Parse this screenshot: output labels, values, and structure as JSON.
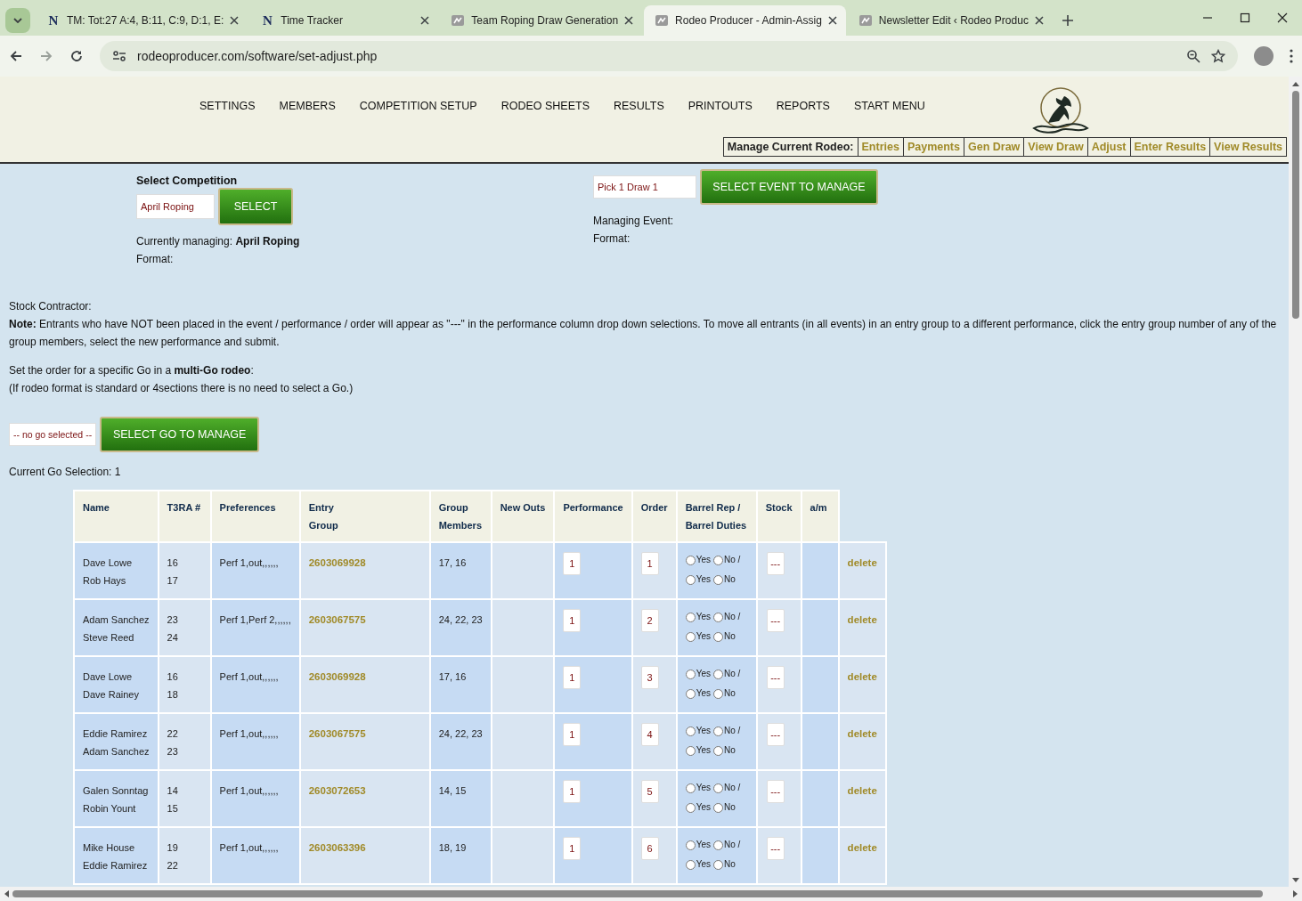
{
  "browser": {
    "tabs": [
      {
        "kind": "letter",
        "icon_text": "N",
        "title": "TM: Tot:27 A:4, B:11, C:9, D:1, E:",
        "selected": false
      },
      {
        "kind": "letter",
        "icon_text": "N",
        "title": "Time Tracker",
        "selected": false
      },
      {
        "kind": "site",
        "title": "Team Roping Draw Generation",
        "selected": false
      },
      {
        "kind": "site",
        "title": "Rodeo Producer - Admin-Assig",
        "selected": true
      },
      {
        "kind": "site",
        "title": "Newsletter Edit ‹ Rodeo Produc",
        "selected": false
      }
    ],
    "address": "rodeoproducer.com/software/set-adjust.php"
  },
  "nav": {
    "items": [
      "SETTINGS",
      "MEMBERS",
      "COMPETITION SETUP",
      "RODEO SHEETS",
      "RESULTS",
      "PRINTOUTS",
      "REPORTS",
      "START MENU"
    ]
  },
  "manage_bar": {
    "label": "Manage Current Rodeo:",
    "links": [
      "Entries",
      "Payments",
      "Gen Draw",
      "View Draw",
      "Adjust",
      "Enter Results",
      "View Results"
    ]
  },
  "competition": {
    "heading": "Select Competition",
    "select_value": "April Roping",
    "button": "SELECT",
    "currently_label": "Currently managing:",
    "currently_value": "April Roping",
    "format_label": "Format:"
  },
  "event": {
    "select_value": "Pick 1 Draw 1",
    "button": "SELECT EVENT TO MANAGE",
    "managing_label": "Managing Event:",
    "format_label": "Format:"
  },
  "stock_contractor": "Stock Contractor:",
  "note": "**Note:** Entrants who have NOT been placed in the event / performance / order will appear as \"---\" in the performance column drop down selections. To move all entrants (in all events) in an entry group to a different performance, click the entry group number of any of the group members, select the new performance and submit.",
  "go_intro": "Set the order for a specific Go in a **multi-Go rodeo**:",
  "go_hint": "(If rodeo format is standard or 4sections there is no need to select a Go.)",
  "go": {
    "select_value": "-- no go selected --",
    "button": "SELECT GO TO MANAGE",
    "current": "Current Go Selection: 1"
  },
  "table": {
    "columns": [
      "Name",
      "T3RA #",
      "Preferences",
      "Entry\nGroup",
      "Group\nMembers",
      "New Outs",
      "Performance",
      "Order",
      "Barrel Rep /\nBarrel Duties",
      "Stock",
      "a/m"
    ],
    "rows": [
      {
        "names": [
          "Dave Lowe",
          "Rob Hays"
        ],
        "t3ra": [
          "16",
          "17"
        ],
        "preferences": "Perf 1,out,,,,,,",
        "entry_group": "2603069928",
        "group_members": "17, 16",
        "performance": "1",
        "order": "1",
        "barrel_rep": [
          {
            "label": "Yes",
            "selected": false
          },
          {
            "label": "No /",
            "selected": false
          }
        ],
        "barrel_duties": [
          {
            "label": "Yes",
            "selected": false
          },
          {
            "label": "No",
            "selected": false
          }
        ],
        "stock": "---",
        "action": "delete"
      },
      {
        "names": [
          "Adam Sanchez",
          "Steve Reed"
        ],
        "t3ra": [
          "23",
          "24"
        ],
        "preferences": "Perf 1,Perf 2,,,,,,",
        "entry_group": "2603067575",
        "group_members": "24, 22, 23",
        "performance": "1",
        "order": "2",
        "barrel_rep": [
          {
            "label": "Yes",
            "selected": false
          },
          {
            "label": "No /",
            "selected": false
          }
        ],
        "barrel_duties": [
          {
            "label": "Yes",
            "selected": false
          },
          {
            "label": "No",
            "selected": false
          }
        ],
        "stock": "---",
        "action": "delete"
      },
      {
        "names": [
          "Dave Lowe",
          "Dave Rainey"
        ],
        "t3ra": [
          "16",
          "18"
        ],
        "preferences": "Perf 1,out,,,,,,",
        "entry_group": "2603069928",
        "group_members": "17, 16",
        "performance": "1",
        "order": "3",
        "barrel_rep": [
          {
            "label": "Yes",
            "selected": false
          },
          {
            "label": "No /",
            "selected": false
          }
        ],
        "barrel_duties": [
          {
            "label": "Yes",
            "selected": false
          },
          {
            "label": "No",
            "selected": false
          }
        ],
        "stock": "---",
        "action": "delete"
      },
      {
        "names": [
          "Eddie Ramirez",
          "Adam Sanchez"
        ],
        "t3ra": [
          "22",
          "23"
        ],
        "preferences": "Perf 1,out,,,,,,",
        "entry_group": "2603067575",
        "group_members": "24, 22, 23",
        "performance": "1",
        "order": "4",
        "barrel_rep": [
          {
            "label": "Yes",
            "selected": false
          },
          {
            "label": "No /",
            "selected": false
          }
        ],
        "barrel_duties": [
          {
            "label": "Yes",
            "selected": false
          },
          {
            "label": "No",
            "selected": false
          }
        ],
        "stock": "---",
        "action": "delete"
      },
      {
        "names": [
          "Galen Sonntag",
          "Robin Yount"
        ],
        "t3ra": [
          "14",
          "15"
        ],
        "preferences": "Perf 1,out,,,,,,",
        "entry_group": "2603072653",
        "group_members": "14, 15",
        "performance": "1",
        "order": "5",
        "barrel_rep": [
          {
            "label": "Yes",
            "selected": false
          },
          {
            "label": "No /",
            "selected": false
          }
        ],
        "barrel_duties": [
          {
            "label": "Yes",
            "selected": false
          },
          {
            "label": "No",
            "selected": false
          }
        ],
        "stock": "---",
        "action": "delete"
      },
      {
        "names": [
          "Mike House",
          "Eddie Ramirez"
        ],
        "t3ra": [
          "19",
          "22"
        ],
        "preferences": "Perf 1,out,,,,,,",
        "entry_group": "2603063396",
        "group_members": "18, 19",
        "performance": "1",
        "order": "6",
        "barrel_rep": [
          {
            "label": "Yes",
            "selected": false
          },
          {
            "label": "No /",
            "selected": false
          }
        ],
        "barrel_duties": [
          {
            "label": "Yes",
            "selected": false
          },
          {
            "label": "No",
            "selected": false
          }
        ],
        "stock": "---",
        "action": "delete"
      }
    ]
  }
}
